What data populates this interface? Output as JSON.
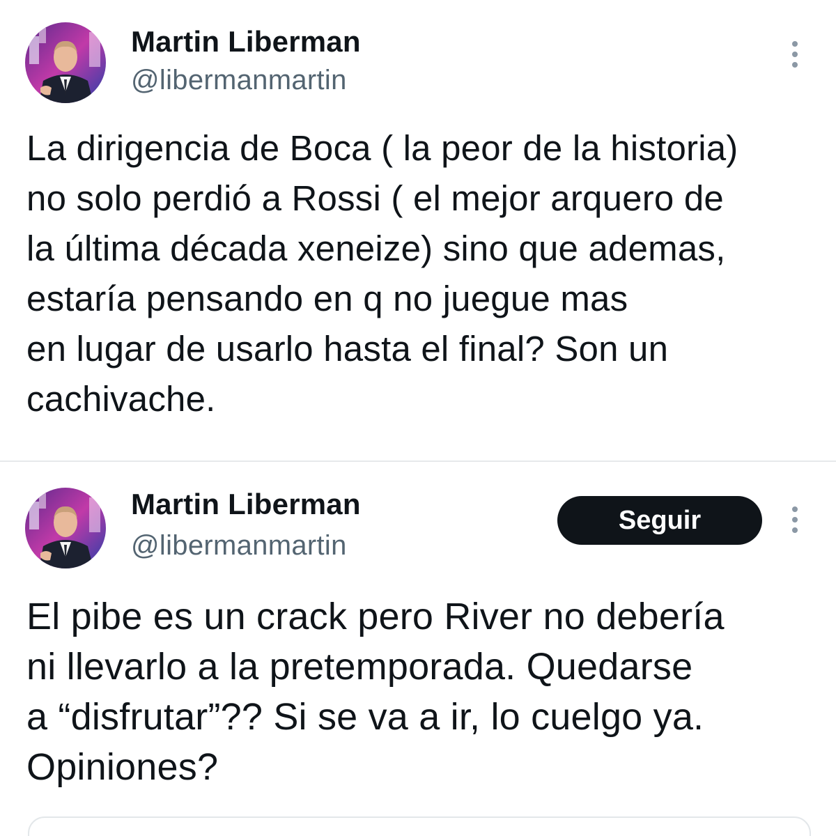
{
  "tweets": [
    {
      "author": {
        "name": "Martin Liberman",
        "handle": "@libermanmartin"
      },
      "text_lines": [
        "La dirigencia de Boca ( la peor de la historia)",
        "no solo perdió a Rossi ( el mejor arquero de",
        "la última década xeneize) sino que ademas,",
        "estaría pensando en q no juegue mas",
        "en lugar de usarlo hasta el final? Son un",
        "cachivache."
      ]
    },
    {
      "author": {
        "name": "Martin Liberman",
        "handle": "@libermanmartin"
      },
      "follow_label": "Seguir",
      "text_lines": [
        "El pibe es un crack pero River no debería",
        "ni llevarlo a la pretemporada. Quedarse",
        "a “disfrutar”?? Si se va a ir, lo cuelgo ya.",
        "Opiniones?"
      ]
    }
  ],
  "icons": {
    "more": "more-vertical-icon",
    "avatar": "profile-photo"
  },
  "colors": {
    "text": "#0f1419",
    "secondary_text": "#536471",
    "follow_button_bg": "#0f1419",
    "follow_button_text": "#ffffff",
    "divider": "#e6e9eb"
  }
}
